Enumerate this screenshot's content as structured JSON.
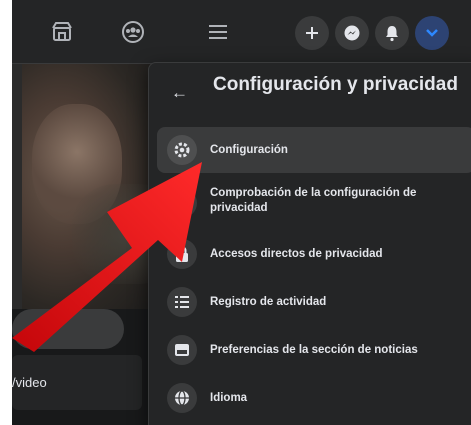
{
  "panel": {
    "title": "Configuración y privacidad",
    "items": [
      {
        "label": "Configuración",
        "icon": "gear-icon"
      },
      {
        "label": "Comprobación de la configuración de privacidad",
        "icon": "lock-check-icon"
      },
      {
        "label": "Accesos directos de privacidad",
        "icon": "lock-icon"
      },
      {
        "label": "Registro de actividad",
        "icon": "list-icon"
      },
      {
        "label": "Preferencias de la sección de noticias",
        "icon": "feed-icon"
      },
      {
        "label": "Idioma",
        "icon": "globe-icon"
      }
    ]
  },
  "left": {
    "card_text": "/video"
  },
  "colors": {
    "background": "#18191a",
    "panel": "#242526",
    "hover": "#3a3b3c",
    "text": "#e4e6eb",
    "arrow": "#e8191a",
    "accent": "#2d88ff"
  }
}
